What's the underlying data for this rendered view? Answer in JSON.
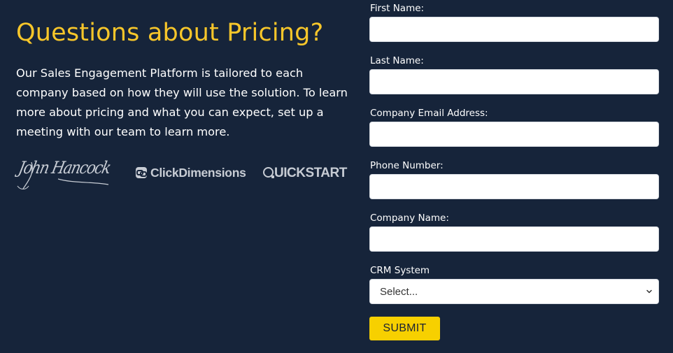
{
  "left": {
    "title": "Questions about Pricing?",
    "intro": "Our Sales Engagement Platform is tailored to each company based on how they will use the solution. To learn more about pricing and what you can expect, set up a meeting with our team to learn more.",
    "logos": [
      {
        "name": "John Hancock",
        "text": "John Hancock"
      },
      {
        "name": "ClickDimensions",
        "text": "ClickDimensions"
      },
      {
        "name": "QuickStart",
        "text_rest": "UICKSTART"
      }
    ]
  },
  "form": {
    "fields": [
      {
        "label": "First Name:",
        "value": "",
        "placeholder": ""
      },
      {
        "label": "Last Name:",
        "value": "",
        "placeholder": ""
      },
      {
        "label": "Company Email Address:",
        "value": "",
        "placeholder": ""
      },
      {
        "label": "Phone Number:",
        "value": "",
        "placeholder": ""
      },
      {
        "label": "Company Name:",
        "value": "",
        "placeholder": ""
      }
    ],
    "crm": {
      "label": "CRM System",
      "selected": "Select..."
    },
    "submit_label": "SUBMIT"
  },
  "colors": {
    "background": "#16243a",
    "title": "#f7c62a",
    "submit": "#f7d000",
    "logo": "#c7ccd4"
  },
  "icons": {
    "select_chevron": "chevron-down-icon"
  }
}
